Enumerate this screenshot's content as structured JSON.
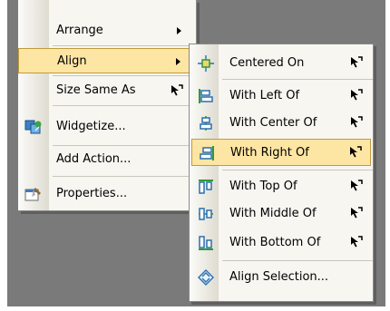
{
  "main_menu": {
    "items": [
      {
        "label": "Arrange",
        "has_submenu": true
      },
      {
        "label": "Align",
        "has_submenu": true,
        "highlighted": true
      },
      {
        "label": "Size Same As",
        "icon": "cursor-pointer-icon"
      },
      {
        "label": "Widgetize...",
        "icon": "widgetize-icon"
      },
      {
        "label": "Add Action..."
      },
      {
        "label": "Properties...",
        "icon": "properties-icon"
      }
    ]
  },
  "align_submenu": {
    "items": [
      {
        "label": "Centered On",
        "icon": "centered-on-icon",
        "shortcut_icon": "cursor-pointer-icon"
      },
      {
        "label": "With Left Of",
        "icon": "align-left-icon",
        "shortcut_icon": "cursor-pointer-icon"
      },
      {
        "label": "With Center Of",
        "icon": "align-center-icon",
        "shortcut_icon": "cursor-pointer-icon"
      },
      {
        "label": "With Right Of",
        "icon": "align-right-icon",
        "shortcut_icon": "cursor-pointer-icon",
        "highlighted": true
      },
      {
        "label": "With Top Of",
        "icon": "align-top-icon",
        "shortcut_icon": "cursor-pointer-icon"
      },
      {
        "label": "With Middle Of",
        "icon": "align-middle-icon",
        "shortcut_icon": "cursor-pointer-icon"
      },
      {
        "label": "With Bottom Of",
        "icon": "align-bottom-icon",
        "shortcut_icon": "cursor-pointer-icon"
      },
      {
        "label": "Align Selection...",
        "icon": "align-selection-icon"
      }
    ]
  },
  "colors": {
    "highlight_fill": "#fde5a3",
    "highlight_border": "#c09b3c",
    "menu_bg": "#f7f6f1",
    "backdrop": "#7a7a7a",
    "icon_blue": "#2a6fb0",
    "icon_green": "#2f9a3a"
  }
}
